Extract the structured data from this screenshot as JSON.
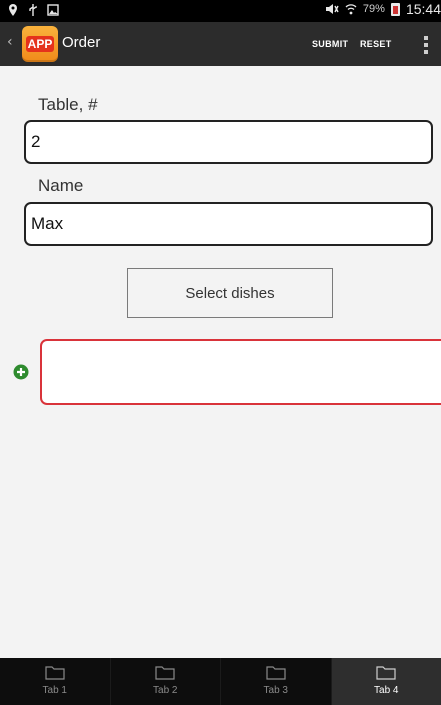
{
  "status_bar": {
    "battery_percent": "79%",
    "time": "15:44"
  },
  "action_bar": {
    "back_glyph": "‹",
    "logo_text": "APP",
    "title": "Order",
    "submit_label": "SUBMIT",
    "reset_label": "RESET"
  },
  "form": {
    "table_label": "Table, #",
    "table_value": "2",
    "name_label": "Name",
    "name_value": "Max",
    "select_dishes_label": "Select dishes"
  },
  "tabs": [
    {
      "label": "Tab 1",
      "active": false
    },
    {
      "label": "Tab 2",
      "active": false
    },
    {
      "label": "Tab 3",
      "active": false
    },
    {
      "label": "Tab 4",
      "active": true
    }
  ],
  "colors": {
    "accent_red": "#d9333a",
    "add_green": "#2e8b2e",
    "action_bar_bg": "#2c2c2c",
    "logo_orange": "#f08a1a"
  }
}
